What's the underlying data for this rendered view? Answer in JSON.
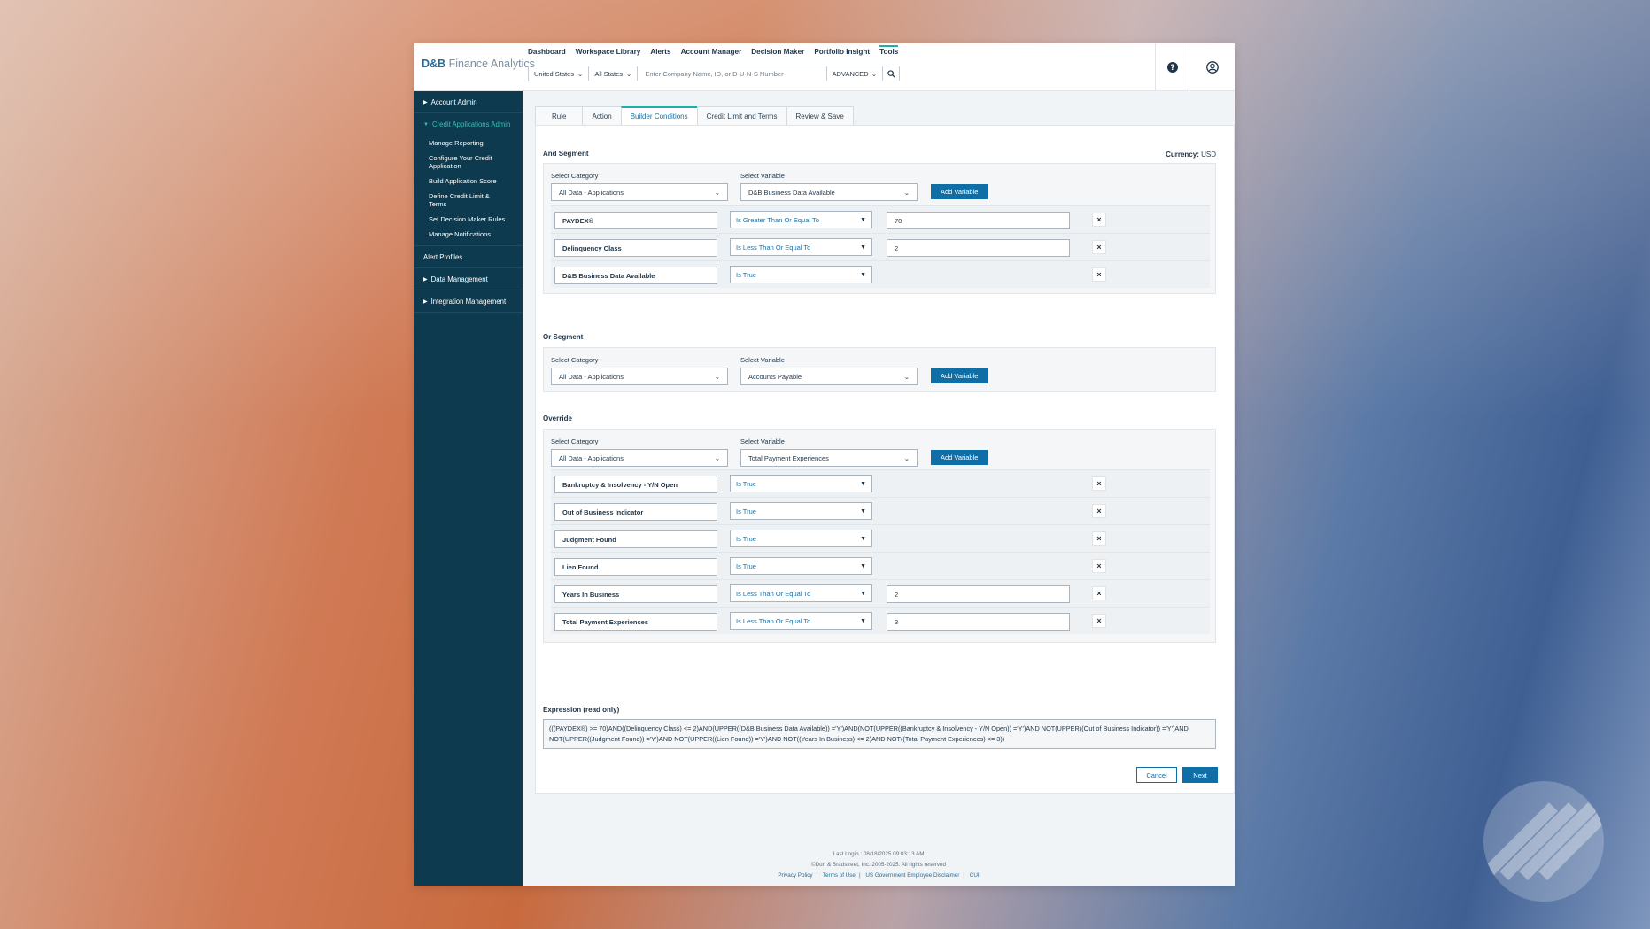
{
  "brand": {
    "prefix": "D&B",
    "name": "Finance Analytics"
  },
  "topnav": [
    "Dashboard",
    "Workspace Library",
    "Alerts",
    "Account Manager",
    "Decision Maker",
    "Portfolio Insight",
    "Tools"
  ],
  "search": {
    "country": "United States",
    "state": "All States",
    "placeholder": "Enter Company Name, ID, or D-U-N-S Number",
    "advanced": "ADVANCED"
  },
  "sidebar": {
    "account_admin": "Account Admin",
    "credit_apps_admin": "Credit Applications Admin",
    "sub_items": [
      "Manage Reporting",
      "Configure Your Credit Application",
      "Build Application Score",
      "Define Credit Limit & Terms",
      "Set Decision Maker Rules",
      "Manage Notifications"
    ],
    "alert_profiles": "Alert Profiles",
    "data_management": "Data Management",
    "integration_management": "Integration Management"
  },
  "tabs": [
    "Rule",
    "Action",
    "Builder Conditions",
    "Credit Limit and Terms",
    "Review & Save"
  ],
  "currency": {
    "label": "Currency:",
    "value": "USD"
  },
  "labels": {
    "select_category": "Select Category",
    "select_variable": "Select Variable",
    "add_variable": "Add Variable"
  },
  "and_segment": {
    "title": "And Segment",
    "category": "All Data - Applications",
    "variable": "D&B Business Data Available",
    "rows": [
      {
        "field": "PAYDEX®",
        "operator": "Is Greater Than Or Equal To",
        "value": "70"
      },
      {
        "field": "Delinquency Class",
        "operator": "Is Less Than Or Equal To",
        "value": "2"
      },
      {
        "field": "D&B Business Data Available",
        "operator": "Is True",
        "value": ""
      }
    ]
  },
  "or_segment": {
    "title": "Or Segment",
    "category": "All Data - Applications",
    "variable": "Accounts Payable"
  },
  "override": {
    "title": "Override",
    "category": "All Data - Applications",
    "variable": "Total Payment Experiences",
    "rows": [
      {
        "field": "Bankruptcy & Insolvency - Y/N Open",
        "operator": "Is True",
        "value": ""
      },
      {
        "field": "Out of Business Indicator",
        "operator": "Is True",
        "value": ""
      },
      {
        "field": "Judgment Found",
        "operator": "Is True",
        "value": ""
      },
      {
        "field": "Lien Found",
        "operator": "Is True",
        "value": ""
      },
      {
        "field": "Years In Business",
        "operator": "Is Less Than Or Equal To",
        "value": "2"
      },
      {
        "field": "Total Payment Experiences",
        "operator": "Is Less Than Or Equal To",
        "value": "3"
      }
    ]
  },
  "expression": {
    "title": "Expression (read only)",
    "text": "(((PAYDEX®) >= 70)AND((Delinquency Class) <= 2)AND(UPPER((D&B Business Data Available)) ='Y')AND(NOT(UPPER((Bankruptcy & Insolvency - Y/N Open)) ='Y')AND NOT(UPPER((Out of Business Indicator)) ='Y')AND NOT(UPPER((Judgment Found)) ='Y')AND NOT(UPPER((Lien Found)) ='Y')AND NOT((Years In Business) <= 2)AND NOT((Total Payment Experiences) <= 3))"
  },
  "buttons": {
    "cancel": "Cancel",
    "next": "Next"
  },
  "footer": {
    "last_login": "Last Login : 08/18/2025 09:03:13 AM",
    "copyright": "©Dun & Bradstreet, Inc. 2005-2025. All rights reserved",
    "links": [
      "Privacy Policy",
      "Terms of Use",
      "US Government Employee Disclaimer",
      "CUI"
    ]
  }
}
